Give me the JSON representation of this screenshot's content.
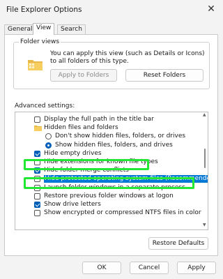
{
  "window": {
    "title": "File Explorer Options"
  },
  "tabs": [
    {
      "label": "General"
    },
    {
      "label": "View"
    },
    {
      "label": "Search"
    }
  ],
  "folder_views": {
    "legend": "Folder views",
    "description": "You can apply this view (such as Details or Icons) to all folders of this type.",
    "apply_label": "Apply to Folders",
    "reset_label": "Reset Folders"
  },
  "advanced": {
    "label": "Advanced settings:",
    "items": [
      {
        "text": "Display the full path in the title bar",
        "control": "checkbox",
        "checked": false
      },
      {
        "text": "Hidden files and folders",
        "control": "folder",
        "checked": false
      },
      {
        "text": "Don't show hidden files, folders, or drives",
        "control": "radio",
        "checked": false
      },
      {
        "text": "Show hidden files, folders, and drives",
        "control": "radio",
        "checked": true
      },
      {
        "text": "Hide empty drives",
        "control": "checkbox",
        "checked": true
      },
      {
        "text": "Hide extensions for known file types",
        "control": "checkbox",
        "checked": false
      },
      {
        "text": "Hide folder merge conflicts",
        "control": "checkbox",
        "checked": true
      },
      {
        "text": "Hide protected operating system files (Recommended)",
        "control": "checkbox",
        "checked": false,
        "selected": true
      },
      {
        "text": "Launch folder windows in a separate process",
        "control": "checkbox",
        "checked": false
      },
      {
        "text": "Restore previous folder windows at logon",
        "control": "checkbox",
        "checked": false
      },
      {
        "text": "Show drive letters",
        "control": "checkbox",
        "checked": true
      },
      {
        "text": "Show encrypted or compressed NTFS files in color",
        "control": "checkbox",
        "checked": false
      }
    ]
  },
  "restore_defaults_label": "Restore Defaults",
  "dialog_buttons": {
    "ok": "OK",
    "cancel": "Cancel",
    "apply": "Apply"
  },
  "colors": {
    "highlight_box": "#23e833",
    "selection": "#0078d4",
    "accent": "#005fb8"
  }
}
